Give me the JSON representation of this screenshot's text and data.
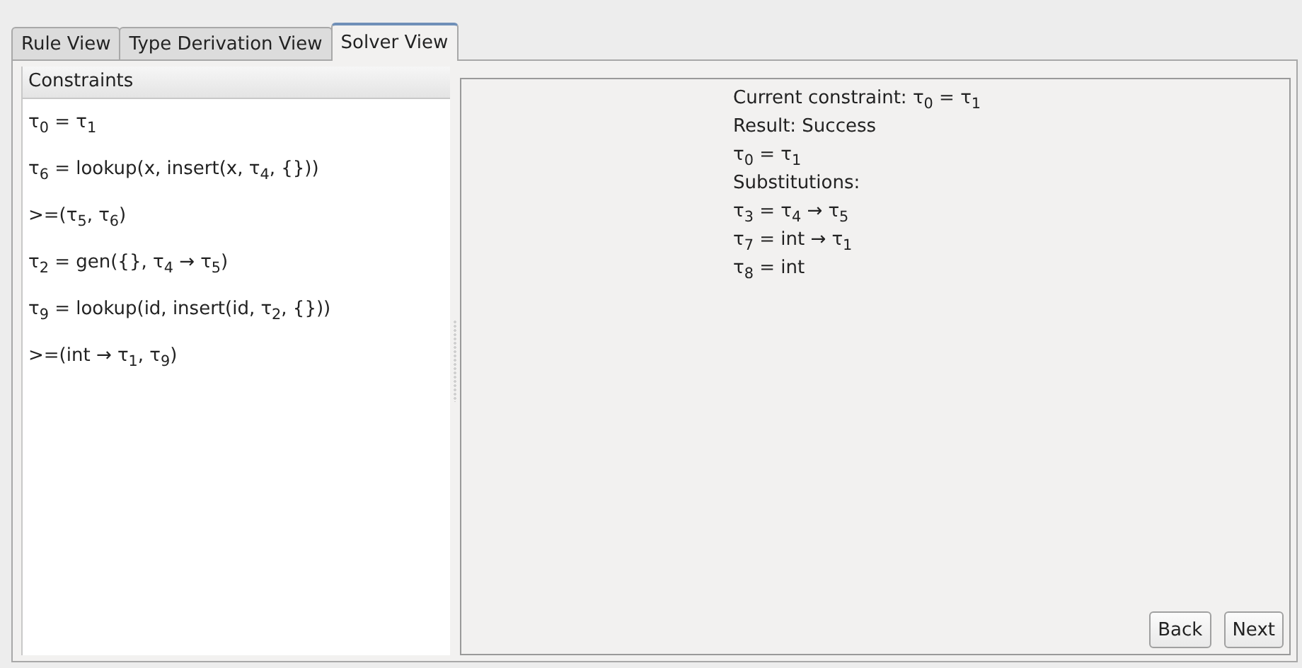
{
  "tabs": [
    {
      "label": "Rule View",
      "selected": false
    },
    {
      "label": "Type Derivation View",
      "selected": false
    },
    {
      "label": "Solver View",
      "selected": true
    }
  ],
  "constraints": {
    "header": "Constraints",
    "items": [
      "τ$_{0}$ = τ$_{1}$",
      "τ$_{6}$ = lookup(x, insert(x, τ$_{4}$, {}))",
      ">=(τ$_{5}$, τ$_{6}$)",
      "τ$_{2}$ = gen({}, τ$_{4}$ → τ$_{5}$)",
      "τ$_{9}$ = lookup(id, insert(id, τ$_{2}$, {}))",
      ">=(int → τ$_{1}$, τ$_{9}$)"
    ]
  },
  "solver": {
    "lines": [
      "Current constraint: τ$_{0}$ = τ$_{1}$",
      "Result: Success",
      "τ$_{0}$ = τ$_{1}$",
      "Substitutions:",
      "τ$_{3}$ = τ$_{4}$ → τ$_{5}$",
      "τ$_{7}$ = int → τ$_{1}$",
      "τ$_{8}$ = int"
    ]
  },
  "buttons": [
    "Back",
    "Next"
  ]
}
